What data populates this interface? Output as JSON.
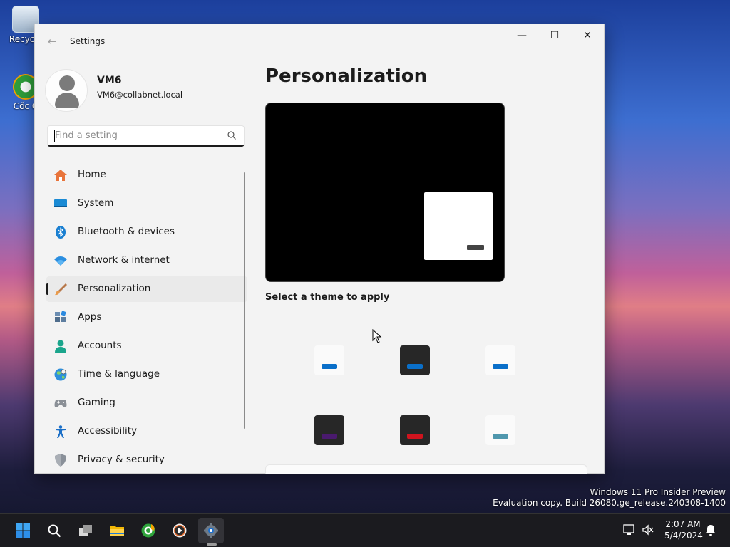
{
  "desktop": {
    "icons": [
      {
        "label": "Recycle"
      },
      {
        "label": "Cốc C"
      }
    ],
    "watermark": {
      "line1": "Windows 11 Pro Insider Preview",
      "line2": "Evaluation copy. Build 26080.ge_release.240308-1400"
    }
  },
  "window": {
    "title": "Settings",
    "controls": {
      "minimize": "—",
      "maximize": "☐",
      "close": "✕"
    }
  },
  "profile": {
    "name": "VM6",
    "email": "VM6@collabnet.local"
  },
  "search": {
    "placeholder": "Find a setting"
  },
  "sidebar": {
    "items": [
      {
        "label": "Home",
        "icon": "home-icon"
      },
      {
        "label": "System",
        "icon": "system-icon"
      },
      {
        "label": "Bluetooth & devices",
        "icon": "bluetooth-icon"
      },
      {
        "label": "Network & internet",
        "icon": "wifi-icon"
      },
      {
        "label": "Personalization",
        "icon": "brush-icon",
        "selected": true
      },
      {
        "label": "Apps",
        "icon": "apps-icon"
      },
      {
        "label": "Accounts",
        "icon": "accounts-icon"
      },
      {
        "label": "Time & language",
        "icon": "globe-icon"
      },
      {
        "label": "Gaming",
        "icon": "gamepad-icon"
      },
      {
        "label": "Accessibility",
        "icon": "accessibility-icon"
      },
      {
        "label": "Privacy & security",
        "icon": "shield-icon"
      }
    ]
  },
  "main": {
    "title": "Personalization",
    "theme_section_label": "Select a theme to apply",
    "themes": [
      {
        "style": "light",
        "accent": "#0a6fc9"
      },
      {
        "style": "dark",
        "accent": "#0a6fc9"
      },
      {
        "style": "light",
        "accent": "#0a6fc9"
      },
      {
        "style": "dark",
        "accent": "#4a1a6e"
      },
      {
        "style": "dark",
        "accent": "#d0141e"
      },
      {
        "style": "light",
        "accent": "#4f97ad"
      }
    ]
  },
  "taskbar": {
    "apps": [
      "start-icon",
      "search-icon",
      "task-view-icon",
      "file-explorer-icon",
      "coccoc-browser-icon",
      "media-player-icon",
      "settings-icon"
    ],
    "time": "2:07 AM",
    "date": "5/4/2024"
  }
}
